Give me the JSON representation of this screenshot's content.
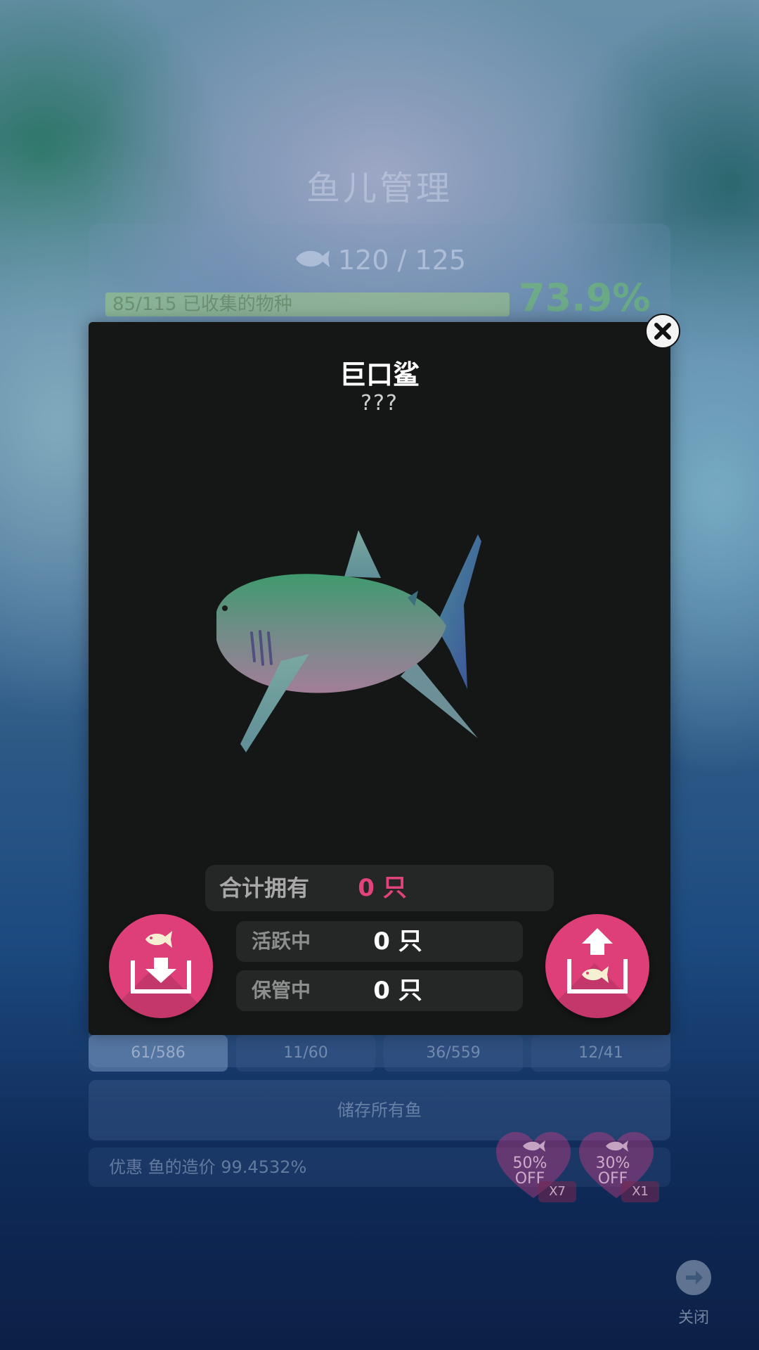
{
  "background": {
    "title": "鱼儿管理",
    "fish_count": "120 / 125",
    "collection_progress": 0.739,
    "collection_text": "85/115 已收集的物种",
    "collection_percent": "73.9%",
    "tabs": [
      {
        "label": "61/586",
        "active": true
      },
      {
        "label": "11/60",
        "active": false
      },
      {
        "label": "36/559",
        "active": false
      },
      {
        "label": "12/41",
        "active": false
      }
    ],
    "store_all_label": "储存所有鱼",
    "discount_text": "优惠 鱼的造价 99.4532%",
    "coupons": [
      {
        "label": "50%",
        "label2": "OFF",
        "mult": "X7"
      },
      {
        "label": "30%",
        "label2": "OFF",
        "mult": "X1"
      }
    ],
    "close_label": "关闭"
  },
  "modal": {
    "title": "巨口鲨",
    "subtitle": "???",
    "total_label": "合计拥有",
    "total_value": "0 只",
    "active_label": "活跃中",
    "active_value": "0 只",
    "stored_label": "保管中",
    "stored_value": "0 只"
  },
  "colors": {
    "accent": "#de3f79",
    "modal_bg": "#151616",
    "stat_bg": "#252626",
    "total_value": "#e2437c"
  },
  "icons": {
    "modal_close": "close-icon",
    "store_button": "fish-store-icon",
    "release_button": "fish-release-icon"
  }
}
